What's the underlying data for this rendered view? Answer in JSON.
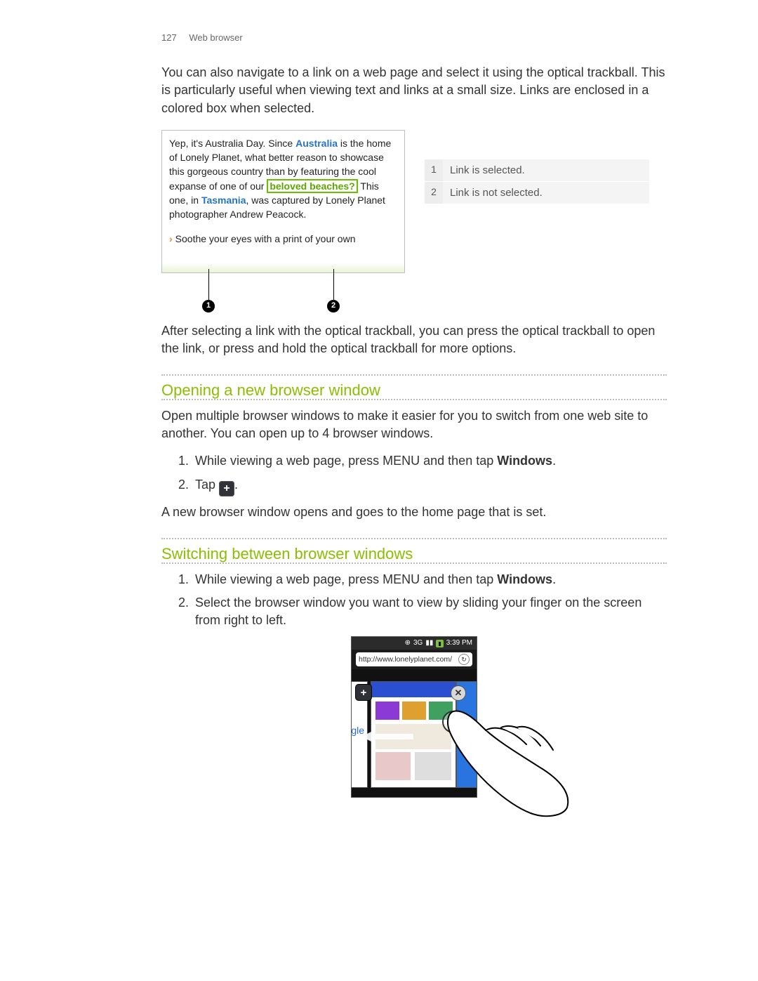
{
  "header": {
    "page_number": "127",
    "section": "Web browser"
  },
  "intro_para": "You can also navigate to a link on a web page and select it using the optical trackball. This is particularly useful when viewing text and links at a small size. Links are enclosed in a colored box when selected.",
  "screenshot1": {
    "t1": "Yep, it's Australia Day. Since ",
    "link_australia": "Australia",
    "t2": " is the home of Lonely Planet, what better reason to showcase this gorgeous country than by featuring the cool expanse of one of our ",
    "selected_link": "beloved beaches?",
    "t3": " This one, in ",
    "link_tasmania": "Tasmania",
    "t4": ", was captured by Lonely Planet photographer Andrew Peacock.",
    "bullet_line": "Soothe your eyes with a print of your own"
  },
  "callouts": {
    "one": "1",
    "two": "2"
  },
  "legend": [
    {
      "num": "1",
      "text": "Link is selected."
    },
    {
      "num": "2",
      "text": "Link is not selected."
    }
  ],
  "after_fig_para": "After selecting a link with the optical trackball, you can press the optical trackball to open the link, or press and hold the optical trackball for more options.",
  "section_open": {
    "heading": "Opening a new browser window",
    "intro": "Open multiple browser windows to make it easier for you to switch from one web site to another. You can open up to 4 browser windows.",
    "step1_a": "While viewing a web page, press MENU and then tap ",
    "step1_b": "Windows",
    "step1_c": ".",
    "step2_a": "Tap ",
    "step2_c": ".",
    "result": "A new browser window opens and goes to the home page that is set."
  },
  "section_switch": {
    "heading": "Switching between browser windows",
    "step1_a": "While viewing a web page, press MENU and then tap ",
    "step1_b": "Windows",
    "step1_c": ".",
    "step2": "Select the browser window you want to view by sliding your finger on the screen from right to left."
  },
  "phone": {
    "time": "3:39 PM",
    "signal": "3G",
    "url": "http://www.lonelyplanet.com/",
    "google_hint": "gle"
  },
  "plus_glyph": "+"
}
